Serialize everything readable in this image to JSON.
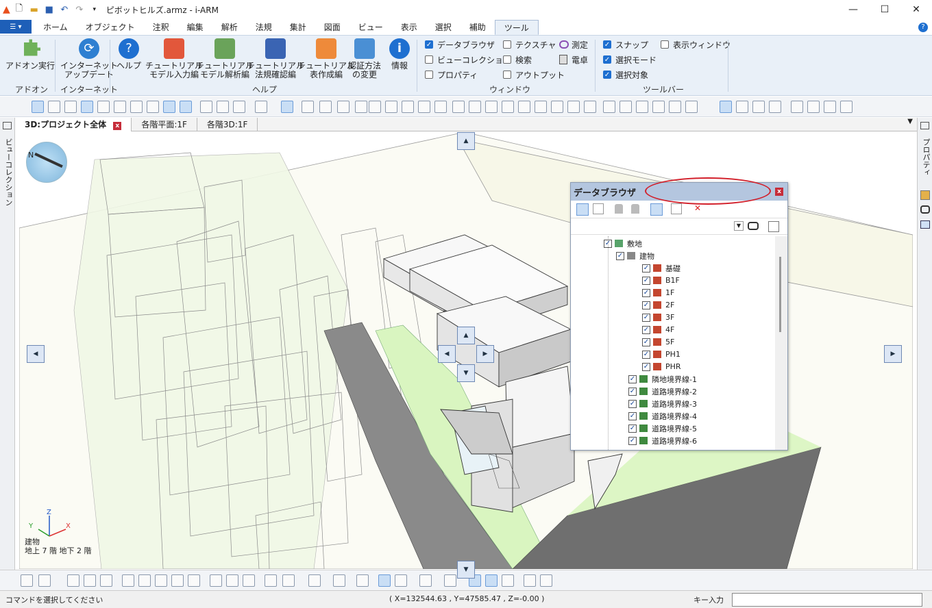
{
  "app": {
    "title": "ピボットヒルズ.armz - i-ARM"
  },
  "ribbon_tabs": [
    "ホーム",
    "オブジェクト",
    "注釈",
    "編集",
    "解析",
    "法規",
    "集計",
    "図面",
    "ビュー",
    "表示",
    "選択",
    "補助",
    "ツール"
  ],
  "ribbon": {
    "addon": {
      "btn1": "アドオン実行",
      "group": "アドオン"
    },
    "internet": {
      "btn1_l1": "インターネット",
      "btn1_l2": "アップデート",
      "group": "インターネット"
    },
    "help": {
      "b1": "ヘルプ",
      "b2_l1": "チュートリアル",
      "b2_l2": "モデル入力編",
      "b3_l1": "チュートリアル",
      "b3_l2": "モデル解析編",
      "b4_l1": "チュートリアル",
      "b4_l2": "法規確認編",
      "b5_l1": "チュートリアル",
      "b5_l2": "表作成編",
      "b6_l1": "認証方法",
      "b6_l2": "の変更",
      "b7": "情報",
      "group": "ヘルプ"
    },
    "window": {
      "c1": "データブラウザ",
      "c2": "ビューコレクション",
      "c3": "プロパティ",
      "c4": "テクスチャ",
      "c5": "検索",
      "c6": "アウトプット",
      "m1": "測定",
      "m2": "電卓",
      "group": "ウィンドウ"
    },
    "toolbar_grp": {
      "c1": "スナップ",
      "c2": "選択モード",
      "c3": "選択対象",
      "c4": "表示ウィンドウ",
      "group": "ツールバー"
    }
  },
  "doc_tabs": [
    "3D:プロジェクト全体",
    "各階平面:1F",
    "各階3D:1F"
  ],
  "left_panel": {
    "label": "ビューコレクション"
  },
  "right_panel": {
    "label": "プロパティ"
  },
  "data_browser": {
    "title": "データブラウザ",
    "tree": [
      {
        "label": "敷地",
        "checked": true
      },
      {
        "label": "建物",
        "checked": true
      },
      {
        "label": "基礎",
        "checked": true
      },
      {
        "label": "B1F",
        "checked": true
      },
      {
        "label": "1F",
        "checked": true
      },
      {
        "label": "2F",
        "checked": true
      },
      {
        "label": "3F",
        "checked": true
      },
      {
        "label": "4F",
        "checked": true
      },
      {
        "label": "5F",
        "checked": true
      },
      {
        "label": "PH1",
        "checked": true
      },
      {
        "label": "PHR",
        "checked": true
      },
      {
        "label": "隣地境界線-1",
        "checked": true
      },
      {
        "label": "道路境界線-2",
        "checked": true
      },
      {
        "label": "道路境界線-3",
        "checked": true
      },
      {
        "label": "道路境界線-4",
        "checked": true
      },
      {
        "label": "道路境界線-5",
        "checked": true
      },
      {
        "label": "道路境界線-6",
        "checked": true
      }
    ]
  },
  "viewport": {
    "compass_label": "N",
    "axis": {
      "z": "Z",
      "y": "Y",
      "x": "X"
    },
    "info_l1": "建物",
    "info_l2": "地上 7 階  地下 2 階"
  },
  "status": {
    "left": "コマンドを選択してください",
    "coords": "( X=132544.63 , Y=47585.47 , Z=-0.00 )",
    "key_label": "キー入力",
    "key_value": ""
  },
  "colors": {
    "ribbon_bg": "#e9f0f8",
    "accent": "#1e6fd0",
    "site_green": "#dff5c8",
    "road_gray": "#8a8a8a"
  }
}
